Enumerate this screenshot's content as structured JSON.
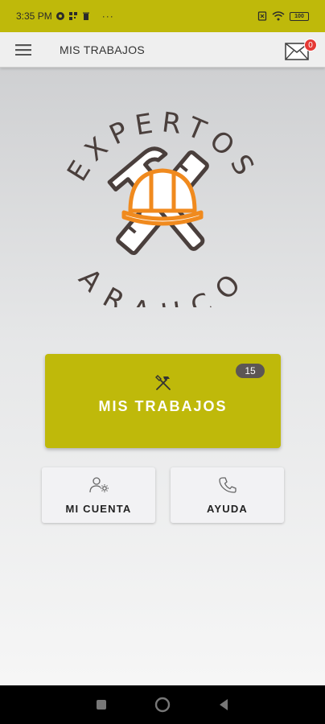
{
  "status_bar": {
    "time": "3:35 PM",
    "battery": "100",
    "icons": [
      "whatsapp-icon",
      "qr-icon",
      "trash-icon",
      "more-icon",
      "sim-icon",
      "wifi-icon",
      "battery-icon"
    ]
  },
  "app_bar": {
    "title": "MIS TRABAJOS",
    "mail_badge": "0"
  },
  "logo": {
    "word_top": "EXPERTOS",
    "word_bottom": "ARAUCO"
  },
  "main_button": {
    "label": "MIS TRABAJOS",
    "count": "15",
    "icon": "tools-icon"
  },
  "cards": [
    {
      "label": "MI CUENTA",
      "icon": "account-settings-icon"
    },
    {
      "label": "AYUDA",
      "icon": "phone-icon"
    }
  ],
  "colors": {
    "accent": "#bfb90a",
    "badge_dark": "#5c5654",
    "mail_badge": "#e53935",
    "logo_dark": "#4a3f3c",
    "helmet_orange": "#f08a1e"
  }
}
